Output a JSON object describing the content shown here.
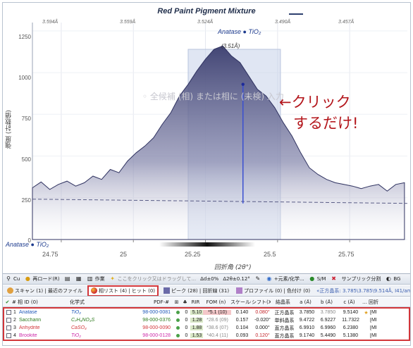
{
  "chart": {
    "title": "Red Paint Pigment Mixture",
    "y_axis_label": "強度 (計数値)",
    "x_axis_label": "回折角 (2θ°)",
    "y_ticks": [
      "1250",
      "1000",
      "750",
      "500",
      "250",
      "0"
    ],
    "x_ticks_bottom": [
      "24.75",
      "25",
      "25.25",
      "25.5",
      "25.75"
    ],
    "x_ticks_top": [
      "3.594Å",
      "3.559Å",
      "3.524Å",
      "3.490Å",
      "3.457Å"
    ],
    "phase_label_top": "Anatase ● TiO₂",
    "phase_label_bottom": "Anatase ● TiO₂",
    "peak_label": "(3.51Å)",
    "watermark": "◦ 全候補 (相) または相に (未検) 入力",
    "callout_line1": "←クリック",
    "callout_line2": "するだけ!",
    "colors": {
      "fill_top": "#3a3d6e",
      "fill_bottom": "#ffffff",
      "highlight": "#c7d2ea",
      "peak_line": "#3a4fd0",
      "callout": "#b3151b"
    }
  },
  "chart_data": {
    "type": "area",
    "title": "Red Paint Pigment Mixture",
    "xlabel": "回折角 (2θ°)",
    "ylabel": "強度 (計数値)",
    "xlim": [
      24.65,
      25.95
    ],
    "ylim": [
      0,
      1300
    ],
    "x": [
      24.65,
      24.68,
      24.71,
      24.74,
      24.77,
      24.8,
      24.83,
      24.86,
      24.89,
      24.92,
      24.95,
      24.98,
      25.01,
      25.04,
      25.07,
      25.1,
      25.13,
      25.16,
      25.19,
      25.22,
      25.25,
      25.28,
      25.31,
      25.34,
      25.37,
      25.4,
      25.43,
      25.46,
      25.49,
      25.52,
      25.55,
      25.58,
      25.61,
      25.64,
      25.67,
      25.7,
      25.73,
      25.76,
      25.79,
      25.82,
      25.85,
      25.88,
      25.91,
      25.94
    ],
    "values": [
      310,
      345,
      300,
      330,
      350,
      320,
      340,
      380,
      360,
      420,
      400,
      470,
      520,
      560,
      610,
      690,
      760,
      860,
      930,
      1010,
      1080,
      1140,
      1160,
      1100,
      1060,
      980,
      900,
      860,
      790,
      700,
      620,
      520,
      430,
      390,
      360,
      340,
      330,
      320,
      305,
      320,
      330,
      290,
      330,
      340
    ],
    "peak": {
      "x": 25.38,
      "y": 930,
      "d_spacing": "3.51Å",
      "phase": "Anatase"
    },
    "baseline": {
      "y": 225
    },
    "highlight_range": [
      25.19,
      25.51
    ],
    "grid": true
  },
  "toolbar": {
    "items": [
      {
        "icon": "magnify-icon",
        "label": "Cu"
      },
      {
        "icon": "circle-icon",
        "label": "再ロード(R)"
      },
      {
        "icon": "doc-icon",
        "label": ""
      },
      {
        "icon": "grid-icon",
        "label": ""
      },
      {
        "icon": "work-icon",
        "label": "作業"
      },
      {
        "icon": "lightbulb-icon",
        "label": "ここをクリック又はドラッグして..."
      },
      {
        "icon": "range-icon",
        "label": "Δd±0%"
      },
      {
        "icon": "angle-icon",
        "label": "Δ2θ±0.12°"
      },
      {
        "icon": "pin-icon",
        "label": ""
      },
      {
        "icon": "element-icon",
        "label": "+元素/化学..."
      },
      {
        "icon": "sm-icon",
        "label": "S/M"
      },
      {
        "icon": "clear-icon",
        "label": ""
      },
      {
        "icon": "sample-icon",
        "label": "サンプリック分割"
      },
      {
        "icon": "more-icon",
        "label": "BG"
      }
    ]
  },
  "tabs": {
    "items": [
      {
        "label": "スキャン (1) | 最近のファイル",
        "active": false
      },
      {
        "label": "相リスト (4) | ヒット (0)",
        "active": true
      },
      {
        "label": "ピーク (28) | 回折線 (31)",
        "active": false
      },
      {
        "label": "プロファイル (0) | 色付け (0)",
        "active": false
      }
    ],
    "filter_text": "«正方晶系: 3.785\\3.785\\9.514Å, I41/amd (141)»"
  },
  "table": {
    "headers": {
      "check": "✔",
      "num": "#",
      "id": "相 ID (0)",
      "formula": "化学式",
      "pdf": "PDF-#",
      "rir": "RIR",
      "fom": "FOM (n)",
      "scale": "スケール(I)",
      "shift": "シフト(X)",
      "system": "結晶系",
      "a": "a (Å)",
      "b": "b (Å)",
      "c": "c (Å)",
      "more": "回折"
    },
    "rows": [
      {
        "num": "1",
        "name": "Anatase",
        "formula": "TiO₂",
        "pdf": "98-000-0081",
        "icon2": "0",
        "rir": "5.10",
        "fom": "*5.1 (10)",
        "scale": "0.140",
        "shift": "0.080°",
        "system": "正方晶系",
        "a": "3.7850",
        "b": "3.7850",
        "c": "9.5140",
        "tail": "[MI",
        "color": "#1f57b8"
      },
      {
        "num": "2",
        "name": "Saccharin",
        "formula": "C₇H₅NO₃S",
        "pdf": "98-000-0376",
        "icon2": "0",
        "rir": "1.28",
        "fom": "*28.6 (09)",
        "scale": "0.157",
        "shift": "-0.020°",
        "system": "単斜晶系",
        "a": "9.4722",
        "b": "6.9227",
        "c": "11.7322",
        "tail": "[MI",
        "color": "#2c7a1c"
      },
      {
        "num": "3",
        "name": "Anhydrite",
        "formula": "CaSO₄",
        "pdf": "98-000-0090",
        "icon2": "0",
        "rir": "1.88",
        "fom": "*38.6 (07)",
        "scale": "0.104",
        "shift": "0.000°",
        "system": "直方晶系",
        "a": "6.9910",
        "b": "6.9960",
        "c": "6.2380",
        "tail": "[MI",
        "color": "#d2363a"
      },
      {
        "num": "4",
        "name": "Brookite",
        "formula": "TiO₂",
        "pdf": "98-000-0128",
        "icon2": "0",
        "rir": "1.53",
        "fom": "*40.4 (11)",
        "scale": "0.093",
        "shift": "0.120°",
        "system": "直方晶系",
        "a": "9.1740",
        "b": "5.4490",
        "c": "5.1380",
        "tail": "[MI",
        "color": "#cc2aa8"
      }
    ]
  }
}
